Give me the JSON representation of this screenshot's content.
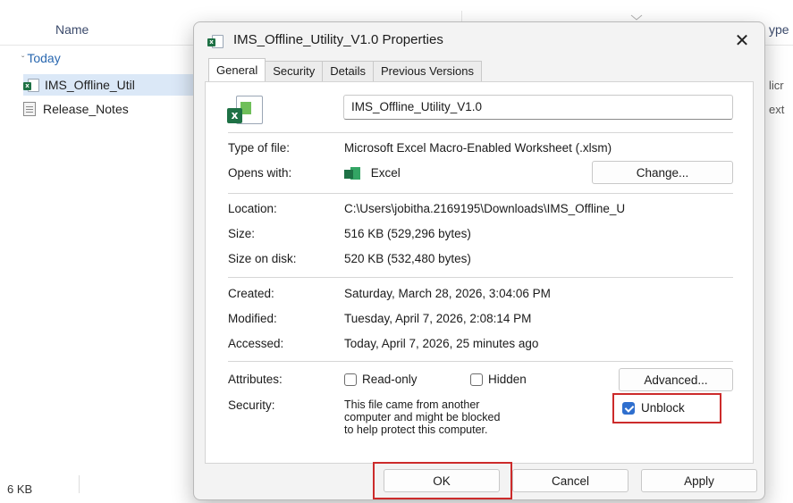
{
  "explorer": {
    "header": {
      "name_col": "Name",
      "type_col": "ype"
    },
    "group_label": "Today",
    "files": [
      {
        "name": "IMS_Offline_Util",
        "type_text": "licr"
      },
      {
        "name": "Release_Notes",
        "type_text": "ext"
      }
    ],
    "status_size": "6 KB"
  },
  "dialog": {
    "title": "IMS_Offline_Utility_V1.0 Properties",
    "close_glyph": "✕",
    "tabs": [
      "General",
      "Security",
      "Details",
      "Previous Versions"
    ],
    "active_tab": "General",
    "file_name_value": "IMS_Offline_Utility_V1.0",
    "type_label": "Type of file:",
    "type_value": "Microsoft Excel Macro-Enabled Worksheet (.xlsm)",
    "opens_label": "Opens with:",
    "opens_value": "Excel",
    "change_button": "Change...",
    "location_label": "Location:",
    "location_value": "C:\\Users\\jobitha.2169195\\Downloads\\IMS_Offline_U",
    "size_label": "Size:",
    "size_value": "516 KB (529,296 bytes)",
    "size_disk_label": "Size on disk:",
    "size_disk_value": "520 KB (532,480 bytes)",
    "created_label": "Created:",
    "created_value": "Saturday, March 28, 2026, 3:04:06 PM",
    "modified_label": "Modified:",
    "modified_value": "Tuesday, April 7, 2026, 2:08:14 PM",
    "accessed_label": "Accessed:",
    "accessed_value": "Today, April 7, 2026, 25 minutes ago",
    "attributes_label": "Attributes:",
    "readonly_label": "Read-only",
    "readonly_checked": false,
    "hidden_label": "Hidden",
    "hidden_checked": false,
    "advanced_button": "Advanced...",
    "security_label": "Security:",
    "security_text": "This file came from another computer and might be blocked to help protect this computer.",
    "unblock_label": "Unblock",
    "unblock_checked": true,
    "ok_button": "OK",
    "cancel_button": "Cancel",
    "apply_button": "Apply",
    "highlight_color": "#cc2b2b",
    "accent_color": "#2f6fce"
  }
}
